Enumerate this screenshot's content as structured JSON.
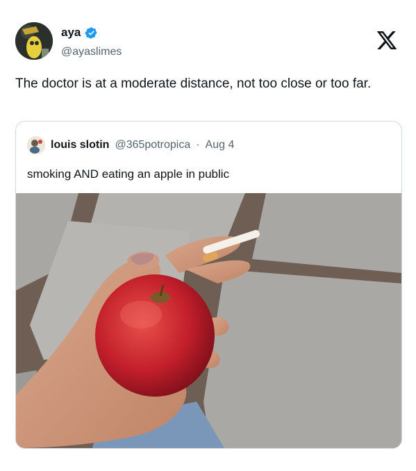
{
  "author": {
    "display_name": "aya",
    "handle": "@ayaslimes",
    "verified": true
  },
  "tweet": {
    "text": "The doctor is at a moderate distance, not too close or too far."
  },
  "quoted": {
    "display_name": "louis slotin",
    "handle": "@365potropica",
    "separator": "·",
    "date": "Aug 4",
    "text": "smoking AND eating an apple in public"
  },
  "colors": {
    "verified": "#1d9bf0",
    "secondary_text": "#536471",
    "border": "#cfd9de"
  },
  "icons": [
    "verified-badge-icon",
    "x-logo-icon"
  ]
}
